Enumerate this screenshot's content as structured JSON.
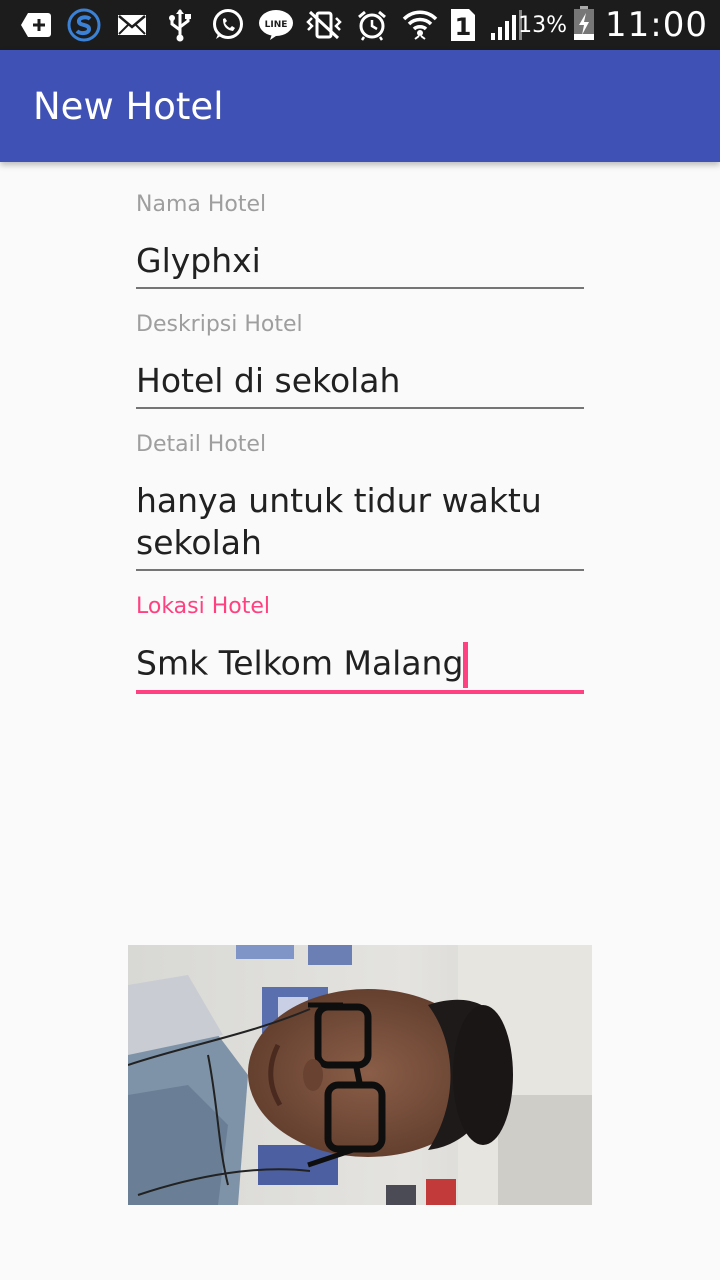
{
  "status_bar": {
    "icons": [
      "add-box-icon",
      "s-app-icon",
      "mail-icon",
      "usb-icon",
      "whatsapp-icon",
      "line-icon",
      "vibrate-mute-icon",
      "alarm-icon",
      "wifi-icon",
      "sim-1-icon",
      "signal-icon",
      "battery-icon"
    ],
    "sim_label": "1",
    "battery_percent": "13%",
    "time": "11:00"
  },
  "app_bar": {
    "title": "New Hotel",
    "color": "#3f51b5"
  },
  "form": {
    "fields": [
      {
        "label": "Nama Hotel",
        "value": "Glyphxi"
      },
      {
        "label": "Deskripsi Hotel",
        "value": "Hotel di sekolah"
      },
      {
        "label": "Detail Hotel",
        "value": "hanya untuk tidur waktu sekolah"
      },
      {
        "label": "Lokasi Hotel",
        "value": "Smk Telkom Malang",
        "focused": true
      }
    ],
    "accent_color": "#ff4081"
  },
  "photo": {
    "subject": "selfie-photo"
  }
}
